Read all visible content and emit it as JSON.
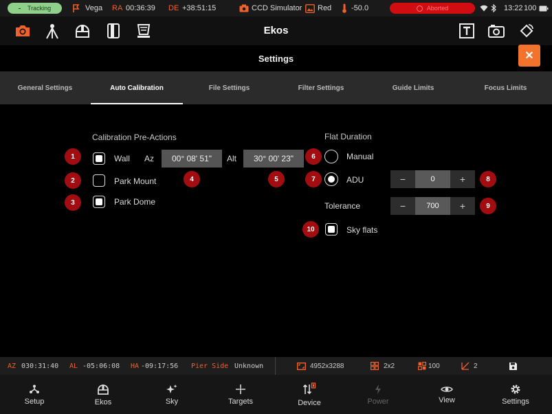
{
  "status_bar": {
    "tracking": "Tracking",
    "target": "Vega",
    "ra_label": "RA",
    "ra_value": "00:36:39",
    "de_label": "DE",
    "de_value": "+38:51:15",
    "camera": "CCD Simulator",
    "filter": "Red",
    "temperature": "-50.0",
    "status": "Aborted",
    "time": "13:22",
    "battery": "100"
  },
  "app_bar": {
    "title": "Ekos",
    "left_icons": [
      "camera-icon",
      "mount-icon",
      "dome-icon",
      "notebook-icon",
      "flat-panel-icon"
    ],
    "right_icons": [
      "text-icon",
      "snapshot-icon",
      "rotate-icon"
    ]
  },
  "settings": {
    "title": "Settings",
    "close_label": "✕"
  },
  "tabs": [
    {
      "label": "General Settings",
      "active": false
    },
    {
      "label": "Auto Calibration",
      "active": true
    },
    {
      "label": "File Settings",
      "active": false
    },
    {
      "label": "Filter Settings",
      "active": false
    },
    {
      "label": "Guide Limits",
      "active": false
    },
    {
      "label": "Focus Limits",
      "active": false
    }
  ],
  "pre_actions": {
    "title": "Calibration Pre-Actions",
    "wall": {
      "label": "Wall",
      "checked": true
    },
    "az_label": "Az",
    "az_value": "00° 08' 51\"",
    "alt_label": "Alt",
    "alt_value": "30° 00' 23\"",
    "park_mount": {
      "label": "Park Mount",
      "checked": false
    },
    "park_dome": {
      "label": "Park Dome",
      "checked": true
    }
  },
  "flat_duration": {
    "title": "Flat Duration",
    "manual": {
      "label": "Manual",
      "selected": false
    },
    "adu": {
      "label": "ADU",
      "selected": true,
      "value": "0"
    },
    "tolerance_label": "Tolerance",
    "tolerance_value": "700",
    "sky_flats": {
      "label": "Sky flats",
      "checked": true
    },
    "minus": "−",
    "plus": "+"
  },
  "badges": [
    "1",
    "2",
    "3",
    "4",
    "5",
    "6",
    "7",
    "8",
    "9",
    "10"
  ],
  "info_bar": {
    "az_label": "AZ",
    "az_value": "030:31:40",
    "al_label": "AL",
    "al_value": "-05:06:08",
    "ha_label": "HA",
    "ha_value": "-09:17:56",
    "pier_label": "Pier Side",
    "pier_value": "Unknown",
    "resolution": "4952x3288",
    "binning": "2x2",
    "gain": "100",
    "count": "2"
  },
  "bottom_nav": [
    {
      "label": "Setup",
      "icon": "setup-icon"
    },
    {
      "label": "Ekos",
      "icon": "ekos-icon"
    },
    {
      "label": "Sky",
      "icon": "sky-icon"
    },
    {
      "label": "Targets",
      "icon": "targets-icon"
    },
    {
      "label": "Device",
      "icon": "device-icon"
    },
    {
      "label": "Power",
      "icon": "power-icon"
    },
    {
      "label": "View",
      "icon": "view-icon"
    },
    {
      "label": "Settings",
      "icon": "settings-icon"
    }
  ],
  "colors": {
    "accent": "#f0612b",
    "tracking": "#8fd18a",
    "aborted": "#d10d12",
    "badge": "#a10d10"
  }
}
